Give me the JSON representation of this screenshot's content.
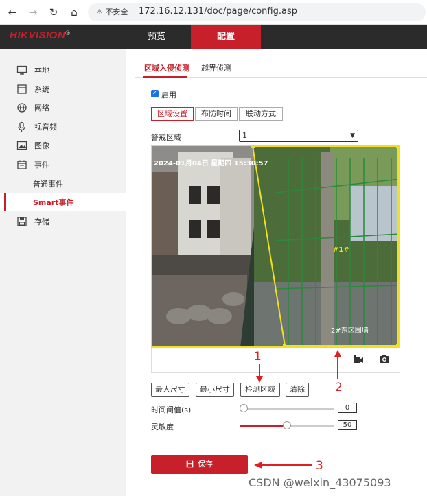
{
  "browser": {
    "security_label": "不安全",
    "url": "172.16.12.131/doc/page/config.asp"
  },
  "header": {
    "logo": "HIKVISION",
    "tabs": [
      {
        "label": "预览"
      },
      {
        "label": "配置"
      }
    ]
  },
  "sidebar": {
    "items": [
      {
        "label": "本地",
        "icon": "monitor-icon"
      },
      {
        "label": "系统",
        "icon": "system-icon"
      },
      {
        "label": "网络",
        "icon": "globe-icon"
      },
      {
        "label": "视音频",
        "icon": "audio-video-icon"
      },
      {
        "label": "图像",
        "icon": "image-icon"
      },
      {
        "label": "事件",
        "icon": "calendar-icon"
      },
      {
        "label": "普通事件"
      },
      {
        "label": "Smart事件"
      },
      {
        "label": "存储",
        "icon": "save-disk-icon"
      }
    ]
  },
  "main": {
    "tabs": [
      {
        "label": "区域入侵侦测"
      },
      {
        "label": "越界侦测"
      }
    ],
    "enable_label": "启用",
    "steps": [
      {
        "label": "区域设置"
      },
      {
        "label": "布防时间"
      },
      {
        "label": "联动方式"
      }
    ],
    "area_label": "警戒区域",
    "area_value": "1",
    "osd": {
      "timestamp": "2024-01月04日 星期四 15:30:57",
      "marker": "#1#",
      "channel": "2#东区围墙"
    },
    "buttons": {
      "max_size": "最大尺寸",
      "min_size": "最小尺寸",
      "detect_area": "检测区域",
      "clear": "清除"
    },
    "time_threshold": {
      "label": "时间阈值(s)",
      "value": "0",
      "level": 0
    },
    "sensitivity": {
      "label": "灵敏度",
      "value": "50",
      "level": 50
    },
    "save_label": "保存"
  },
  "annotations": {
    "one": "1",
    "two": "2",
    "three": "3"
  },
  "watermark": "CSDN @weixin_43075093",
  "colors": {
    "accent": "#c8202a",
    "header": "#2b2b2b",
    "sidebar": "#f2f2f2",
    "region": "#f0e020"
  }
}
